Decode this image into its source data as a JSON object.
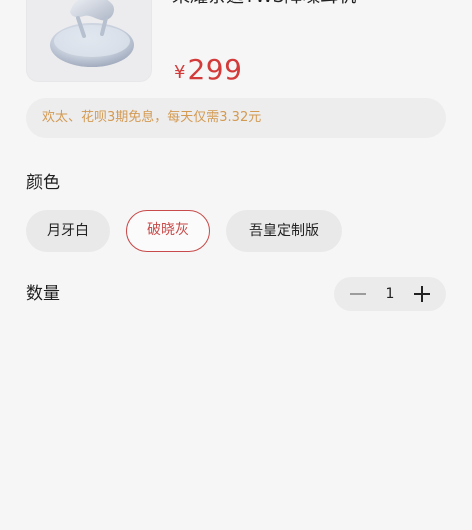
{
  "product": {
    "title": "荣耀亲选TWS降噪耳机",
    "price_currency": "¥",
    "price_amount": "299"
  },
  "promo": {
    "text": "欢太、花呗3期免息，每天仅需3.32元"
  },
  "color": {
    "label": "颜色",
    "options": [
      {
        "label": "月牙白",
        "selected": false
      },
      {
        "label": "破晓灰",
        "selected": true
      },
      {
        "label": "吾皇定制版",
        "selected": false
      }
    ]
  },
  "quantity": {
    "label": "数量",
    "value": "1"
  },
  "colors": {
    "accent_red": "#c84a4a",
    "price_red": "#d33a3a",
    "promo_text": "#d39a52"
  }
}
